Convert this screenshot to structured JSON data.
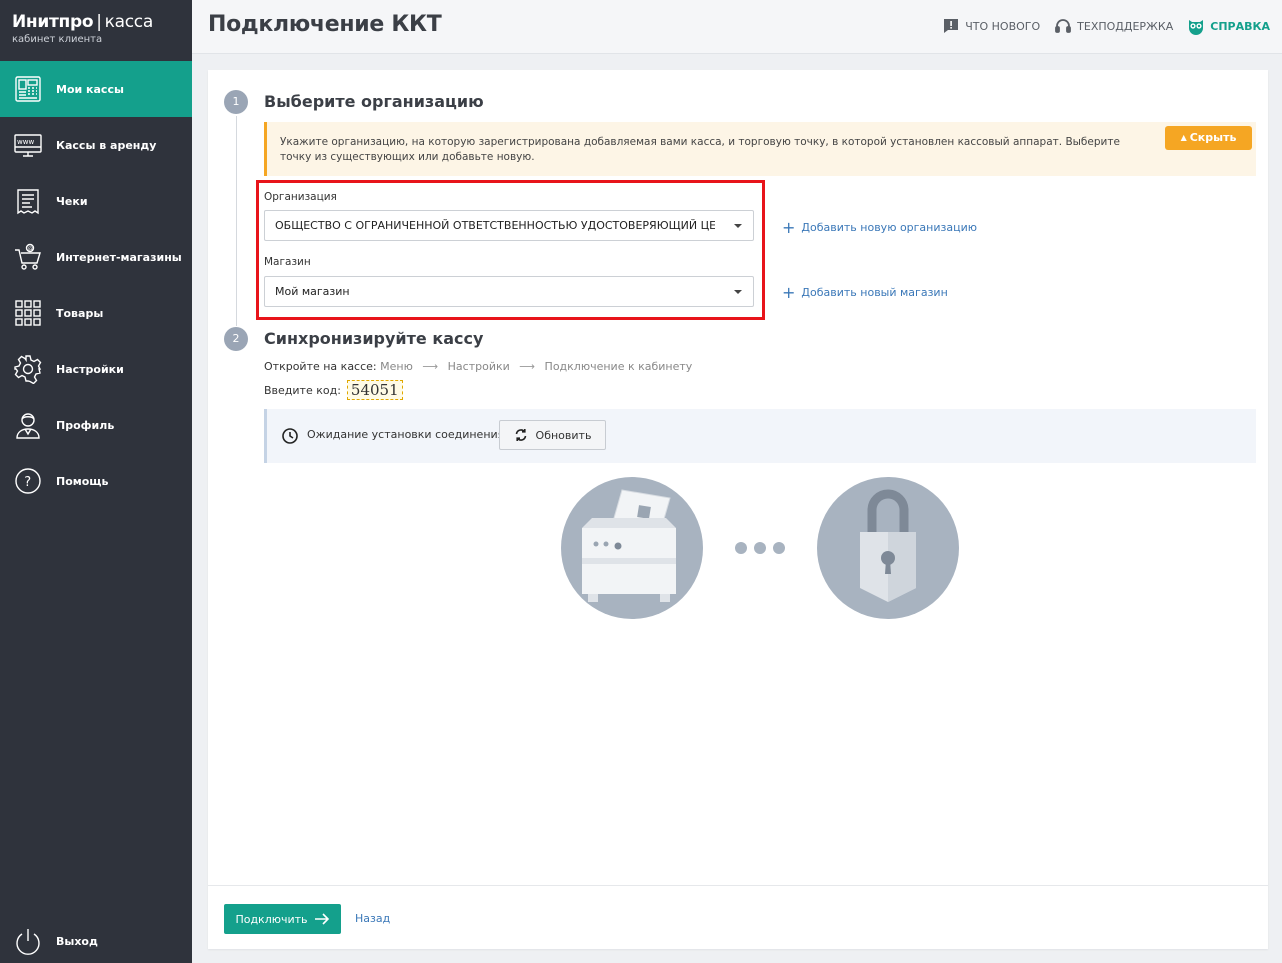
{
  "brand": {
    "name_part1": "Инитпро",
    "separator": "|",
    "name_part2": "касса",
    "subtitle": "кабинет клиента"
  },
  "sidebar": {
    "items": [
      {
        "label": "Мои кассы",
        "icon": "cash-register-icon",
        "active": true
      },
      {
        "label": "Кассы в аренду",
        "icon": "www-monitor-icon",
        "active": false
      },
      {
        "label": "Чеки",
        "icon": "receipt-icon",
        "active": false
      },
      {
        "label": "Интернет-магазины",
        "icon": "shopping-cart-icon",
        "active": false
      },
      {
        "label": "Товары",
        "icon": "grid-icon",
        "active": false
      },
      {
        "label": "Настройки",
        "icon": "gear-icon",
        "active": false
      },
      {
        "label": "Профиль",
        "icon": "user-icon",
        "active": false
      },
      {
        "label": "Помощь",
        "icon": "help-icon",
        "active": false
      }
    ],
    "logout_label": "Выход"
  },
  "header": {
    "title": "Подключение ККТ",
    "links": {
      "whats_new": "ЧТО НОВОГО",
      "support": "ТЕХПОДДЕРЖКА",
      "help": "СПРАВКА"
    }
  },
  "step1": {
    "number": "1",
    "title": "Выберите организацию",
    "info_text": "Укажите организацию, на которую зарегистрирована добавляемая вами касса, и торговую точку, в которой установлен кассовый аппарат. Выберите точку из существующих или добавьте новую.",
    "hide_label": "Скрыть",
    "organization_label": "Организация",
    "organization_value": "ОБЩЕСТВО С ОГРАНИЧЕННОЙ ОТВЕТСТВЕННОСТЬЮ УДОСТОВЕРЯЮЩИЙ ЦЕНТР",
    "add_organization": "Добавить новую организацию",
    "store_label": "Магазин",
    "store_value": "Мой магазин",
    "add_store": "Добавить новый магазин"
  },
  "step2": {
    "number": "2",
    "title": "Синхронизируйте кассу",
    "path_prefix": "Откройте на кассе:",
    "path": [
      "Меню",
      "Настройки",
      "Подключение к кабинету"
    ],
    "code_label": "Введите код:",
    "code": "54051",
    "status_text": "Ожидание установки соединения",
    "refresh_label": "Обновить"
  },
  "footer": {
    "connect_label": "Подключить",
    "back_label": "Назад"
  },
  "colors": {
    "accent": "#14a08c",
    "sidebar": "#2f333c",
    "warning": "#f5a623",
    "highlight": "#e8141a",
    "link": "#3b78b8"
  }
}
